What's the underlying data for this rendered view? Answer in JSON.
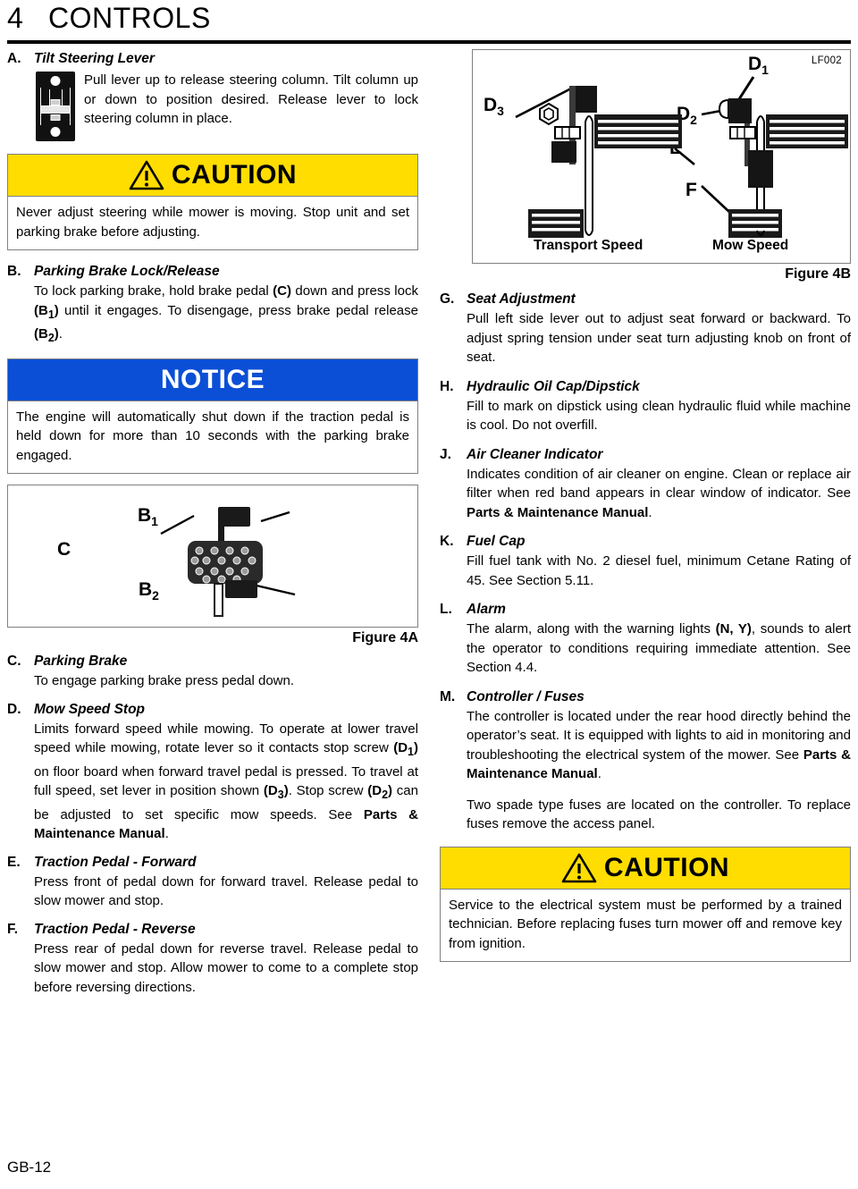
{
  "header": {
    "chapter_number": "4",
    "chapter_title": "CONTROLS"
  },
  "footer": {
    "page_label": "GB-12"
  },
  "colors": {
    "caution_banner": "#FFDD00",
    "notice_banner": "#0B4FD6",
    "box_border": "#808080"
  },
  "left_column": {
    "item_a": {
      "letter": "A.",
      "title": "Tilt Steering Lever",
      "text": "Pull lever up to release steering column. Tilt column up or down to position desired. Release lever to lock steering column in place."
    },
    "caution_1": {
      "word": "CAUTION",
      "text": "Never adjust steering while mower is moving. Stop unit and set parking brake before adjusting."
    },
    "item_b": {
      "letter": "B.",
      "title": "Parking Brake Lock/Release",
      "text_1": "To lock parking brake, hold brake pedal ",
      "ref_c": "(C)",
      "text_2": " down and press lock ",
      "ref_b1": "(B1)",
      "text_3": " until it engages. To disengage, press brake pedal release ",
      "ref_b2": "(B2)",
      "text_4": "."
    },
    "notice": {
      "word": "NOTICE",
      "text": "The engine will automatically shut down if the traction pedal is held down for more than 10 seconds with the parking brake engaged."
    },
    "figure_4a": {
      "caption": "Figure 4A",
      "labels": {
        "c": "C",
        "b1_base": "B",
        "b1_sub": "1",
        "b2_base": "B",
        "b2_sub": "2"
      }
    },
    "item_c": {
      "letter": "C.",
      "title": "Parking Brake",
      "text": "To engage parking brake press pedal down."
    },
    "item_d": {
      "letter": "D.",
      "title": "Mow Speed Stop",
      "text_1": "Limits forward speed while mowing. To operate at lower travel speed while mowing, rotate lever so it contacts stop screw ",
      "ref_d1": "(D1)",
      "text_2": " on floor board when forward travel pedal is pressed. To travel at full speed, set lever in position shown ",
      "ref_d3": "(D3)",
      "text_3": ". Stop screw ",
      "ref_d2": "(D2)",
      "text_4": " can be adjusted to set specific mow speeds. See ",
      "manual_ref": "Parts & Maintenance Manual",
      "text_5": "."
    },
    "item_e": {
      "letter": "E.",
      "title": "Traction Pedal - Forward",
      "text": "Press front of pedal down for forward travel. Release pedal to slow mower and stop."
    },
    "item_f": {
      "letter": "F.",
      "title": "Traction Pedal - Reverse",
      "text": "Press rear of pedal down for reverse travel. Release pedal to slow mower and stop. Allow mower to come to a complete stop before reversing directions."
    }
  },
  "right_column": {
    "figure_4b": {
      "caption": "Figure 4B",
      "code": "LF002",
      "labels": {
        "d1_base": "D",
        "d1_sub": "1",
        "d2_base": "D",
        "d2_sub": "2",
        "d3_base": "D",
        "d3_sub": "3",
        "e": "E",
        "f": "F"
      },
      "transport_speed": "Transport Speed",
      "mow_speed": "Mow Speed"
    },
    "item_g": {
      "letter": "G.",
      "title": "Seat Adjustment",
      "text": "Pull left side lever out to adjust seat forward or backward. To adjust spring tension under seat turn adjusting knob on front of seat."
    },
    "item_h": {
      "letter": "H.",
      "title": "Hydraulic Oil Cap/Dipstick",
      "text": "Fill to mark on dipstick using clean hydraulic fluid while machine is cool. Do not overfill."
    },
    "item_j": {
      "letter": "J.",
      "title": "Air Cleaner Indicator",
      "text_1": "Indicates condition of air cleaner on engine. Clean or replace air filter when red band appears in clear window of indicator. See ",
      "manual_ref": "Parts & Maintenance Manual",
      "text_2": "."
    },
    "item_k": {
      "letter": "K.",
      "title": "Fuel Cap",
      "text": "Fill fuel tank with No. 2 diesel fuel, minimum Cetane Rating of 45. See Section 5.11."
    },
    "item_l": {
      "letter": "L.",
      "title": "Alarm",
      "text_1": "The alarm, along with the warning lights ",
      "ref_ny": "(N, Y)",
      "text_2": ", sounds to alert the operator to conditions requiring immediate attention. See Section 4.4."
    },
    "item_m": {
      "letter": "M.",
      "title": "Controller / Fuses",
      "text_1": "The controller is located under the rear hood directly behind the operator’s seat. It is equipped with lights to aid in monitoring and troubleshooting the electrical system of the mower. See ",
      "manual_ref": "Parts & Maintenance",
      "manual_ref2": "Manual",
      "text_2": ".",
      "paragraph_2": "Two spade type fuses are located on the controller. To replace fuses remove the access panel."
    },
    "caution_2": {
      "word": "CAUTION",
      "text": "Service to the electrical system must be performed by a trained technician. Before replacing fuses turn mower off and remove key from ignition."
    }
  }
}
